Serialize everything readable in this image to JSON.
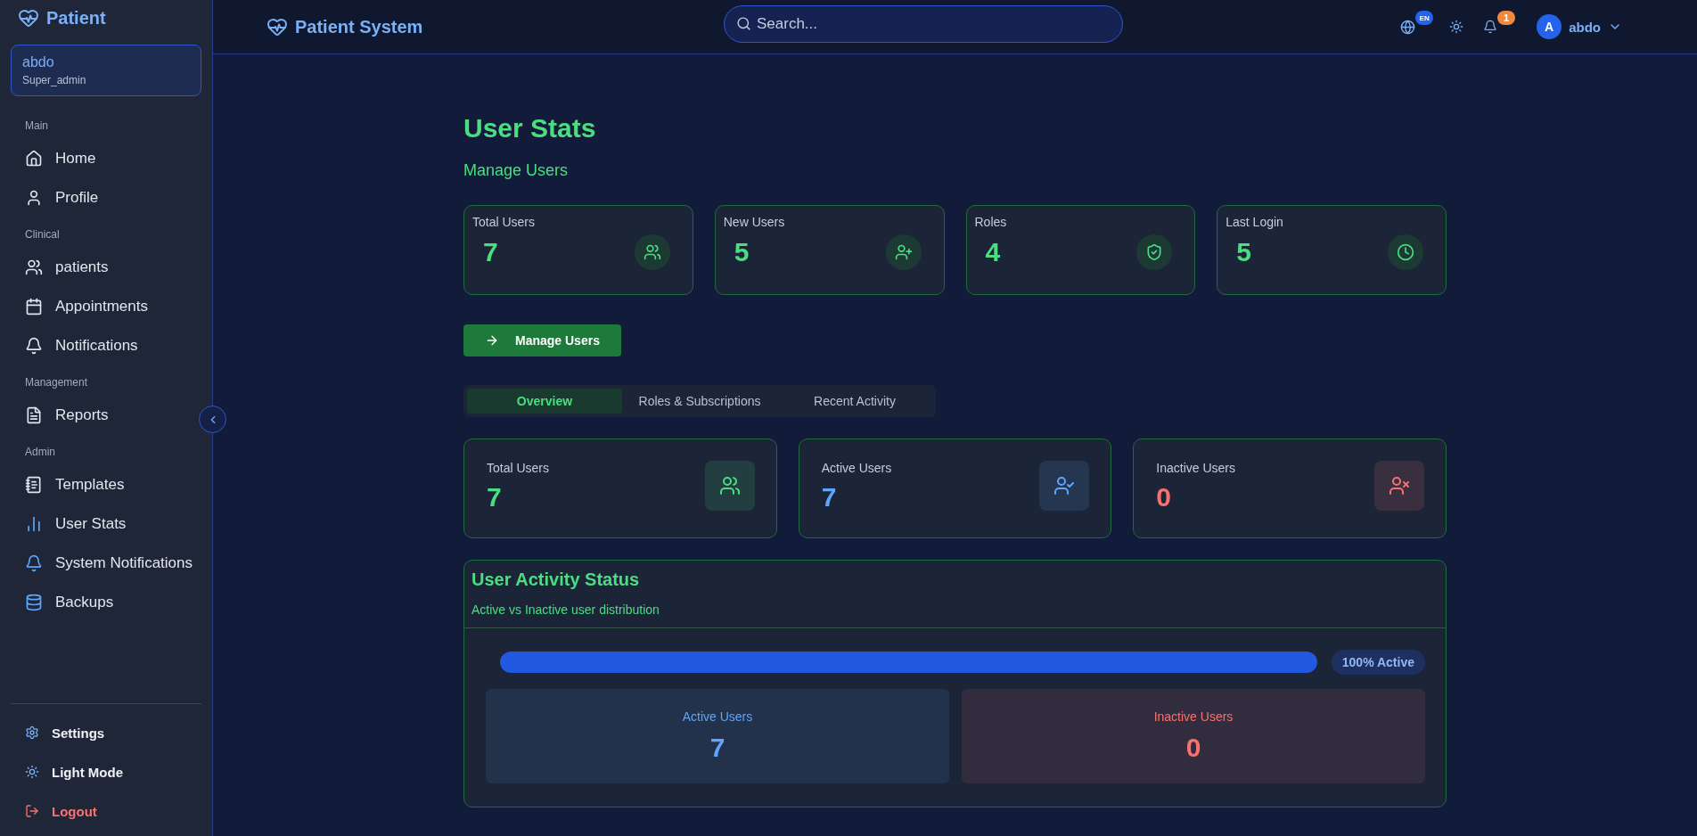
{
  "brand": {
    "name": "Patient"
  },
  "user_card": {
    "name": "abdo",
    "role": "Super_admin"
  },
  "sidebar": {
    "sections": [
      {
        "title": "Main",
        "items": [
          {
            "label": "Home",
            "highlighted": false
          },
          {
            "label": "Profile",
            "highlighted": false
          }
        ]
      },
      {
        "title": "Clinical",
        "items": [
          {
            "label": "patients",
            "highlighted": false
          },
          {
            "label": "Appointments",
            "highlighted": false
          },
          {
            "label": "Notifications",
            "highlighted": false
          }
        ]
      },
      {
        "title": "Management",
        "items": [
          {
            "label": "Reports",
            "highlighted": false
          }
        ]
      },
      {
        "title": "Admin",
        "items": [
          {
            "label": "Templates",
            "highlighted": false
          },
          {
            "label": "User Stats",
            "highlighted": true
          },
          {
            "label": "System Notifications",
            "highlighted": true
          },
          {
            "label": "Backups",
            "highlighted": true
          }
        ]
      }
    ],
    "footer": [
      {
        "label": "Settings",
        "kind": "normal"
      },
      {
        "label": "Light Mode",
        "kind": "normal"
      },
      {
        "label": "Logout",
        "kind": "danger"
      }
    ]
  },
  "topbar": {
    "title": "Patient System",
    "search": {
      "placeholder": "Search..."
    },
    "language": "EN",
    "notification_count": "1",
    "avatar": "A",
    "username": "abdo"
  },
  "page": {
    "title": "User Stats",
    "subtitle": "Manage Users"
  },
  "stat_cards": [
    {
      "label": "Total Users",
      "value": "7"
    },
    {
      "label": "New Users",
      "value": "5"
    },
    {
      "label": "Roles",
      "value": "4"
    },
    {
      "label": "Last Login",
      "value": "5"
    }
  ],
  "action_button": "Manage Users",
  "tabs": [
    {
      "label": "Overview",
      "selected": true
    },
    {
      "label": "Roles & Subscriptions",
      "selected": false
    },
    {
      "label": "Recent Activity",
      "selected": false
    }
  ],
  "summary_cards": [
    {
      "label": "Total Users",
      "value": "7",
      "color": "#4ade80"
    },
    {
      "label": "Active Users",
      "value": "7",
      "color": "#60a5fa"
    },
    {
      "label": "Inactive Users",
      "value": "0",
      "color": "#f87171"
    }
  ],
  "activity": {
    "title": "User Activity Status",
    "subtitle": "Active vs Inactive user distribution",
    "level": 1,
    "reading": "100% Active",
    "boxes": [
      {
        "label": "Active Users",
        "value": "7",
        "color": "#60a5fa"
      },
      {
        "label": "Inactive Users",
        "value": "0",
        "color": "#f87171"
      }
    ]
  }
}
